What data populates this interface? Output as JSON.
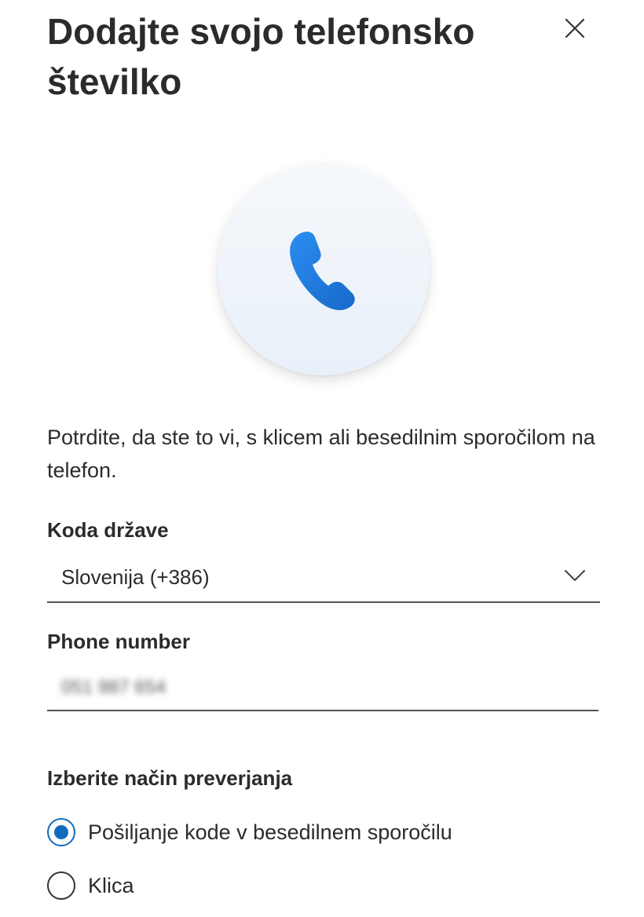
{
  "dialog": {
    "title": "Dodajte svojo telefonsko številko",
    "close_icon": "close-icon",
    "hero_icon": "phone-icon",
    "description": "Potrdite, da ste to vi, s klicem ali besedilnim sporočilom na telefon."
  },
  "country": {
    "label": "Koda države",
    "selected": "Slovenija (+386)",
    "chevron_icon": "chevron-down-icon"
  },
  "phone": {
    "label": "Phone number",
    "value": "051 987 654"
  },
  "verification": {
    "label": "Izberite način preverjanja",
    "options": [
      {
        "label": "Pošiljanje kode v besedilnem sporočilu",
        "checked": true
      },
      {
        "label": "Klica",
        "checked": false
      }
    ]
  },
  "colors": {
    "accent": "#0f6cbd",
    "phone_icon_top": "#2b8ef0",
    "phone_icon_bottom": "#1769c9"
  }
}
